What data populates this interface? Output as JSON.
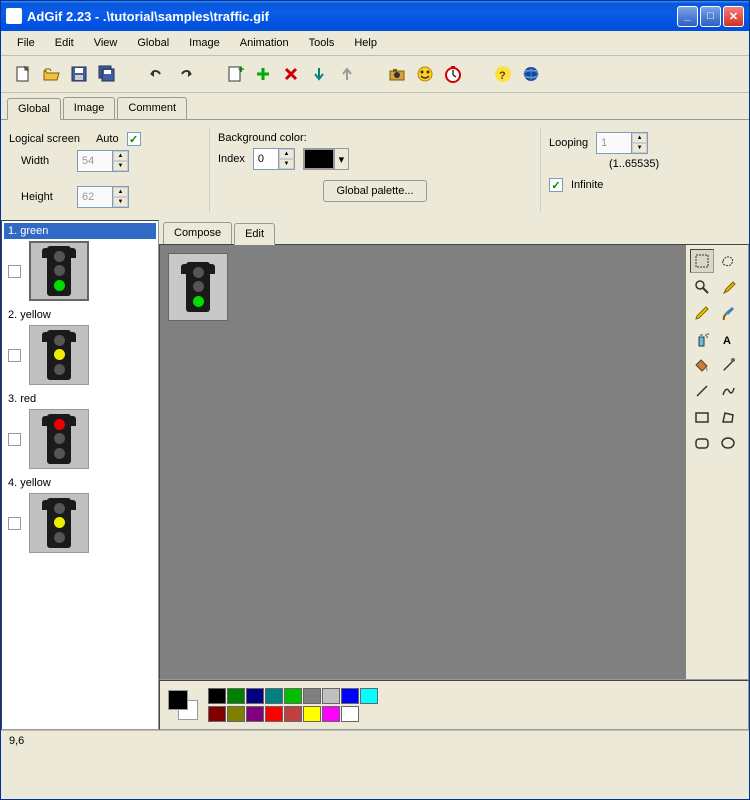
{
  "title": "AdGif 2.23 - .\\tutorial\\samples\\traffic.gif",
  "menu": [
    "File",
    "Edit",
    "View",
    "Global",
    "Image",
    "Animation",
    "Tools",
    "Help"
  ],
  "tabs_main": {
    "global": "Global",
    "image": "Image",
    "comment": "Comment"
  },
  "global_panel": {
    "logical_screen": "Logical screen",
    "auto": "Auto",
    "auto_checked": true,
    "width_label": "Width",
    "width_value": "54",
    "height_label": "Height",
    "height_value": "62",
    "bg_color_label": "Background color:",
    "index_label": "Index",
    "index_value": "0",
    "global_palette_btn": "Global palette...",
    "looping_label": "Looping",
    "looping_value": "1",
    "looping_range": "(1..65535)",
    "infinite_label": "Infinite",
    "infinite_checked": true
  },
  "frames": [
    {
      "label": "1. green",
      "lit": "green",
      "selected": true
    },
    {
      "label": "2. yellow",
      "lit": "yellow",
      "selected": false
    },
    {
      "label": "3. red",
      "lit": "red",
      "selected": false
    },
    {
      "label": "4. yellow",
      "lit": "yellow",
      "selected": false
    }
  ],
  "editor_tabs": {
    "compose": "Compose",
    "edit": "Edit"
  },
  "palette_colors": {
    "row1": [
      "#000000",
      "#008000",
      "#000080",
      "#008080",
      "#00c000",
      "#808080",
      "#c0c0c0",
      "#0000ff",
      "#00ffff"
    ],
    "row2": [
      "#800000",
      "#808000",
      "#800080",
      "#ff0000",
      "#c04040",
      "#ffff00",
      "#ff00ff",
      "#ffffff"
    ]
  },
  "status_text": "9,6"
}
